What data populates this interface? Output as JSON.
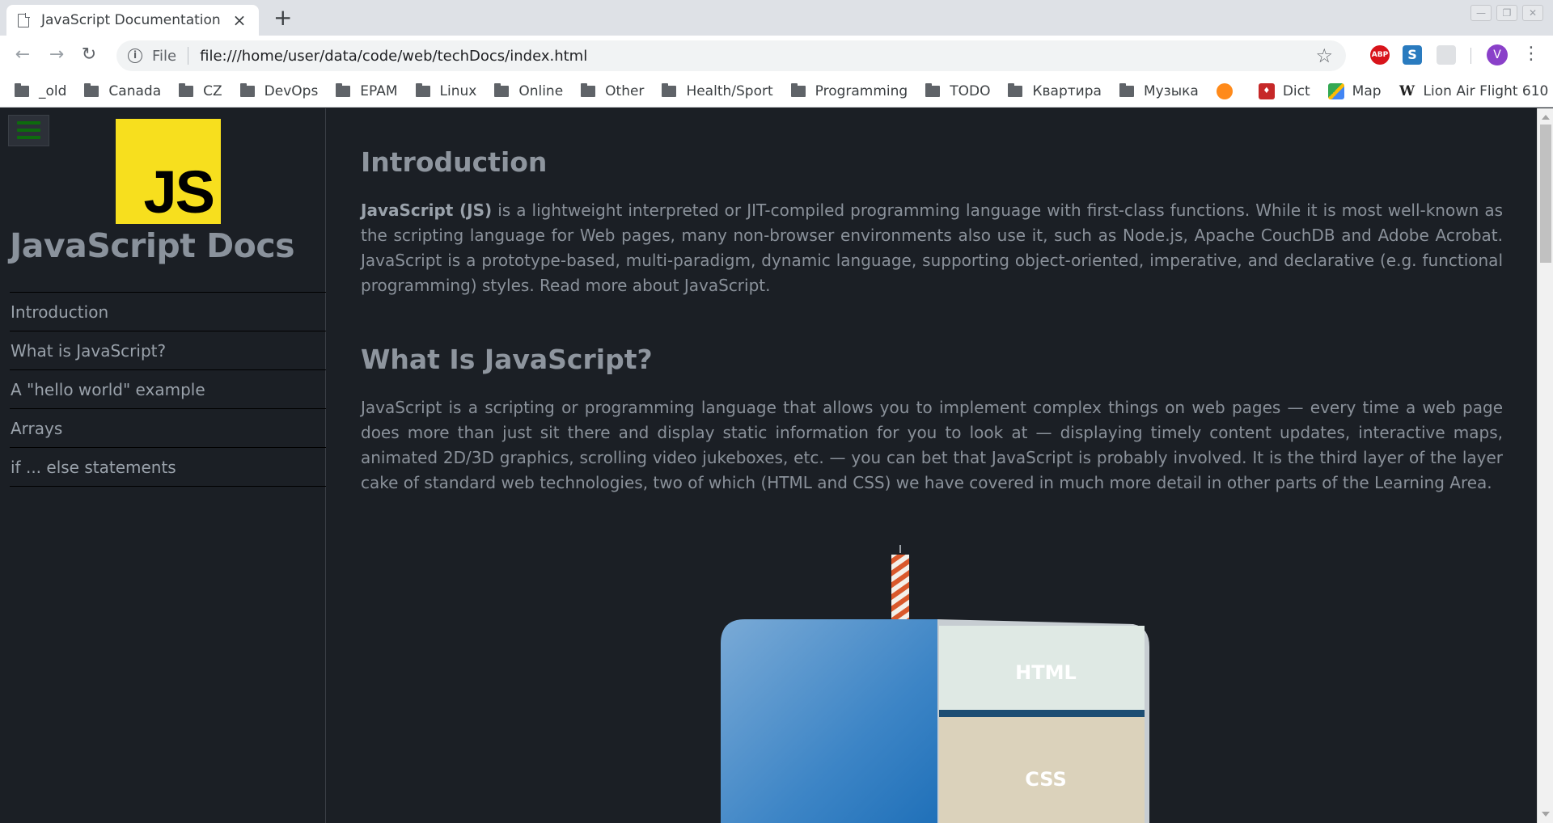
{
  "browser": {
    "tab_title": "JavaScript Documentation",
    "tab_close": "×",
    "new_tab": "+",
    "scheme_label": "File",
    "url": "file:///home/user/data/code/web/techDocs/index.html",
    "profile_initial": "V",
    "ext_abp": "ABP",
    "ext_s": "S",
    "bookmarks": [
      "_old",
      "Canada",
      "CZ",
      "DevOps",
      "EPAM",
      "Linux",
      "Online",
      "Other",
      "Health/Sport",
      "Programming",
      "TODO",
      "Квартира",
      "Музыка"
    ],
    "bookmark_dict": "Dict",
    "bookmark_map": "Map",
    "bookmark_wiki": "Lion Air Flight 610",
    "wiki_glyph": "W"
  },
  "sidebar": {
    "logo_text": "JS",
    "title": "JavaScript Docs",
    "nav": [
      "Introduction",
      "What is JavaScript?",
      "A \"hello world\" example",
      "Arrays",
      "if ... else statements"
    ]
  },
  "main": {
    "section1": {
      "heading": "Introduction",
      "lead_bold": "JavaScript (JS)",
      "paragraph": " is a lightweight interpreted or JIT-compiled programming language with first-class functions. While it is most well-known as the scripting language for Web pages, many non-browser environments also use it, such as Node.js, Apache CouchDB and Adobe Acrobat. JavaScript is a prototype-based, multi-paradigm, dynamic language, supporting object-oriented, imperative, and declarative (e.g. functional programming) styles. Read more about JavaScript."
    },
    "section2": {
      "heading": "What Is JavaScript?",
      "paragraph": "JavaScript is a scripting or programming language that allows you to implement complex things on web pages — every time a web page does more than just sit there and display static information for you to look at — displaying timely content updates, interactive maps, animated 2D/3D graphics, scrolling video jukeboxes, etc. — you can bet that JavaScript is probably involved. It is the third layer of the layer cake of standard web technologies, two of which (HTML and CSS) we have covered in much more detail in other parts of the Learning Area."
    },
    "diagram": {
      "layer_html": "HTML",
      "layer_css": "CSS"
    }
  }
}
